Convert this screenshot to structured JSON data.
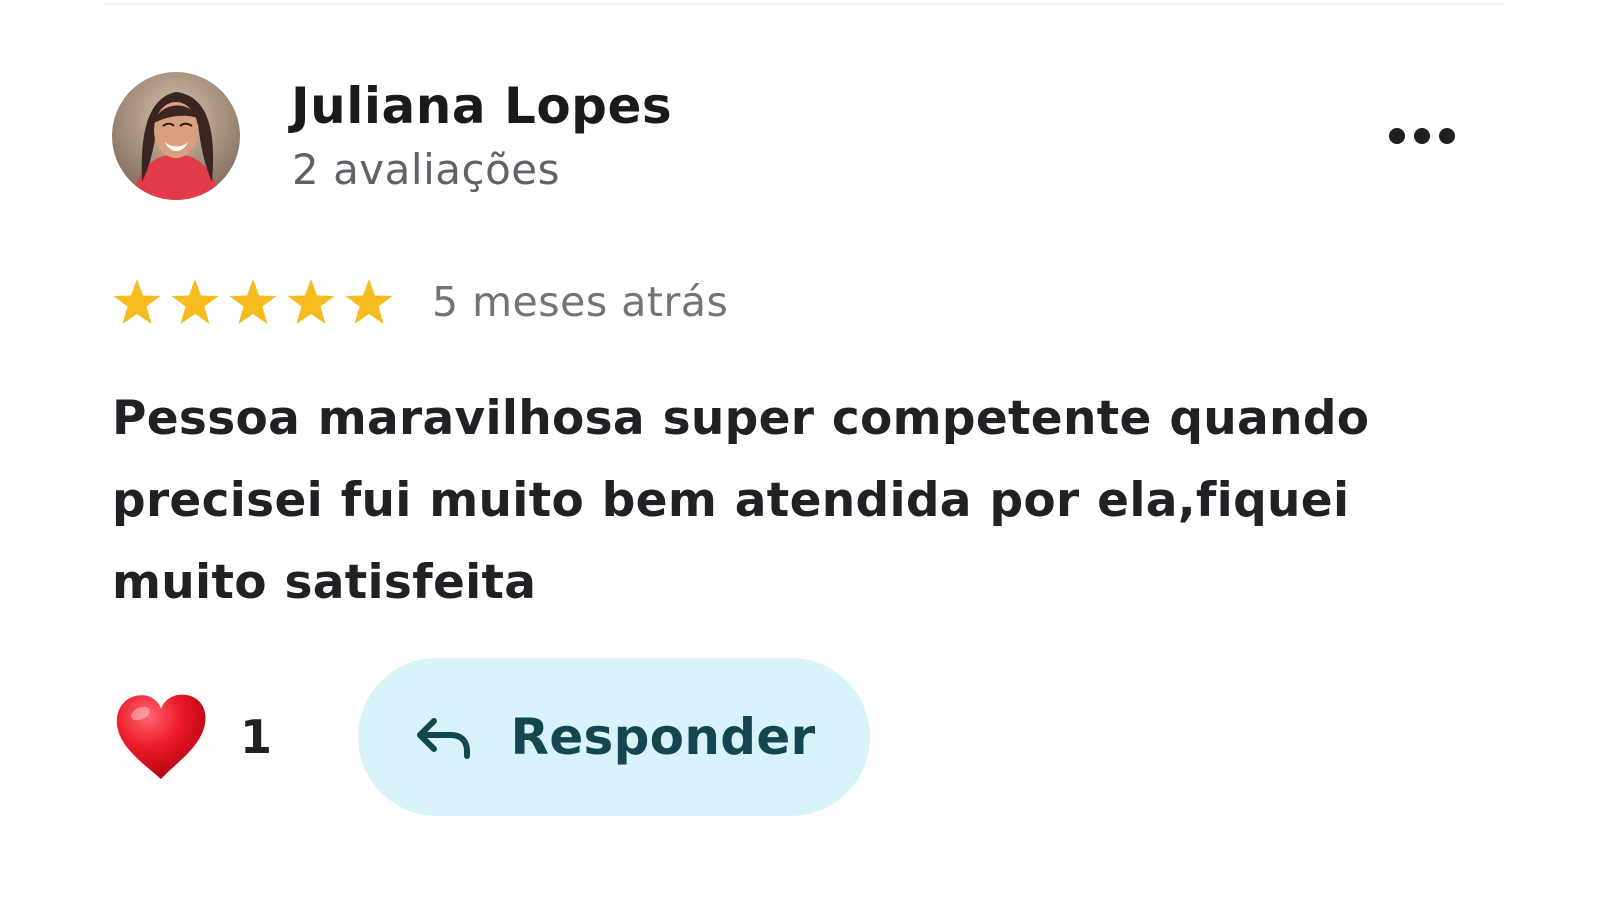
{
  "review": {
    "author_name": "Juliana Lopes",
    "review_count": "2 avaliações",
    "rating": 5,
    "rating_max": 5,
    "timestamp": "5 meses atrás",
    "text_lines": [
      "Pessoa maravilhosa super competente quando",
      "precisei fui muito bem atendida por ela,fiquei",
      "muito satisfeita"
    ],
    "like_count": "1",
    "reply_label": "Responder"
  },
  "icons": {
    "avatar": "profile-photo",
    "more": "more-horizontal-icon",
    "star": "star-icon",
    "heart": "heart-icon",
    "reply": "reply-arrow-icon"
  },
  "colors": {
    "star": "#f6bb1f",
    "heart": "#e0141e",
    "reply_background": "#d9f3fb",
    "reply_text": "#13474f",
    "secondary_text": "#5f6368"
  }
}
